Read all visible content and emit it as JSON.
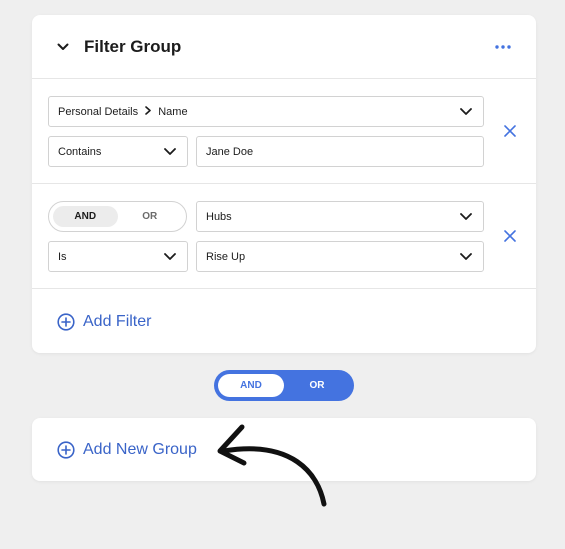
{
  "filter_group": {
    "title": "Filter Group",
    "collapse_icon": "chevron-down-icon",
    "more_icon": "more-horizontal-icon",
    "rows": [
      {
        "field_path": [
          "Personal Details",
          "Name"
        ],
        "operator": "Contains",
        "value": "Jane Doe"
      },
      {
        "logic_toggle": {
          "options": [
            "AND",
            "OR"
          ],
          "selected": "AND"
        },
        "field": "Hubs",
        "operator": "Is",
        "value": "Rise Up"
      }
    ],
    "add_filter_label": "Add Filter"
  },
  "group_logic_toggle": {
    "options": [
      "AND",
      "OR"
    ],
    "selected": "AND"
  },
  "add_group": {
    "label": "Add New Group"
  },
  "colors": {
    "accent": "#4473e0",
    "link": "#3a64c8",
    "background": "#efefef",
    "card": "#ffffff"
  }
}
